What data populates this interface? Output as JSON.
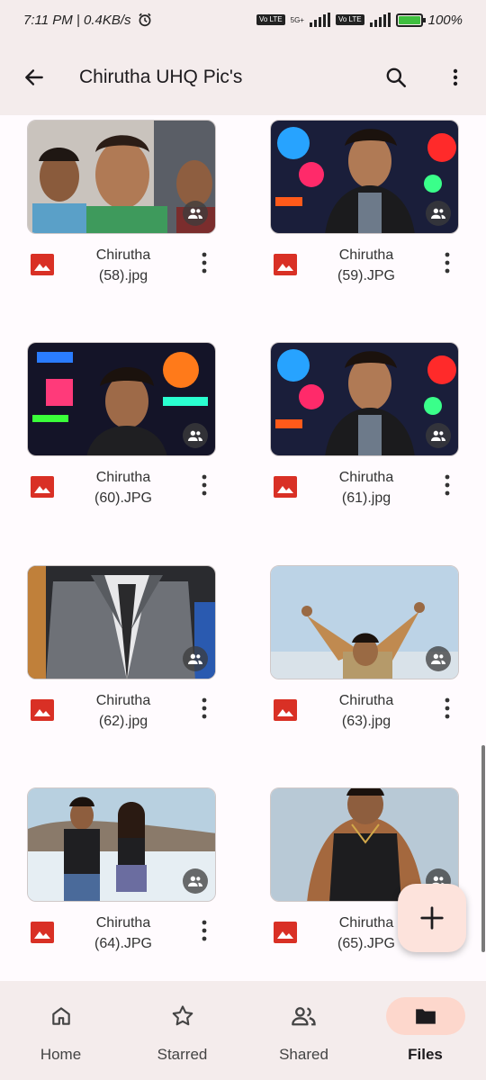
{
  "status_bar": {
    "time_speed": "7:11 PM | 0.4KB/s",
    "net1": "Vo LTE",
    "net_type": "5G+",
    "net2": "Vo LTE",
    "battery": "100%"
  },
  "app_bar": {
    "title": "Chirutha UHQ Pic's"
  },
  "files": [
    {
      "name_line1": "Chirutha",
      "name_line2": "(58).jpg",
      "thumb": "group-men-portrait"
    },
    {
      "name_line1": "Chirutha",
      "name_line2": "(59).JPG",
      "thumb": "man-neon-lights"
    },
    {
      "name_line1": "Chirutha",
      "name_line2": "(60).JPG",
      "thumb": "man-neon-street"
    },
    {
      "name_line1": "Chirutha",
      "name_line2": "(61).jpg",
      "thumb": "man-neon-lights"
    },
    {
      "name_line1": "Chirutha",
      "name_line2": "(62).jpg",
      "thumb": "man-grey-suit"
    },
    {
      "name_line1": "Chirutha",
      "name_line2": "(63).jpg",
      "thumb": "man-arms-raised-sky"
    },
    {
      "name_line1": "Chirutha",
      "name_line2": "(64).JPG",
      "thumb": "couple-on-beach"
    },
    {
      "name_line1": "Chirutha",
      "name_line2": "(65).JPG",
      "thumb": "man-black-vest"
    }
  ],
  "nav": {
    "home": "Home",
    "starred": "Starred",
    "shared": "Shared",
    "files": "Files"
  },
  "colors": {
    "surface": "#f4ecec",
    "background": "#fffbfe",
    "active_pill": "#fdd7cc",
    "fab": "#fde3dc",
    "image_icon": "#d93025"
  }
}
